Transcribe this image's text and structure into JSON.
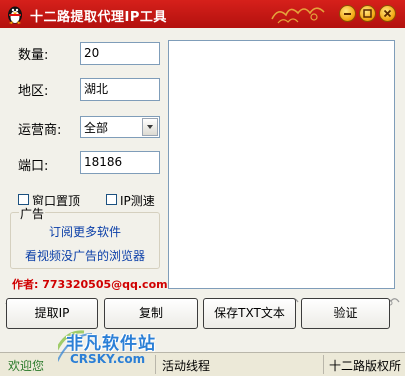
{
  "window": {
    "title": "十二路提取代理IP工具",
    "icons": [
      "penguin-logo-icon",
      "minimize-icon",
      "maximize-icon",
      "close-icon"
    ],
    "title_color": "#c8161a",
    "button_color": "#f2a20c"
  },
  "form": {
    "quantity_label": "数量:",
    "quantity_value": "20",
    "region_label": "地区:",
    "region_value": "湖北",
    "carrier_label": "运营商:",
    "carrier_value": "全部",
    "port_label": "端口:",
    "port_value": "18186"
  },
  "options": {
    "pin_window_label": "窗口置顶",
    "ip_speed_test_label": "IP测速"
  },
  "ad": {
    "group_label": "广告",
    "link1": "订阅更多软件",
    "link2": "看视频没广告的浏览器",
    "link_color": "#0b3fa8"
  },
  "author": {
    "label": "作者:",
    "contact": "773320505@qq.com"
  },
  "buttons": {
    "extract": "提取IP",
    "copy": "复制",
    "save_txt": "保存TXT文本",
    "verify": "验证"
  },
  "status": {
    "left": "欢迎您",
    "middle": "活动线程",
    "right": "十二路版权所"
  },
  "watermark": {
    "line1": "非凡软件站",
    "line2": "CRSKY.com"
  }
}
